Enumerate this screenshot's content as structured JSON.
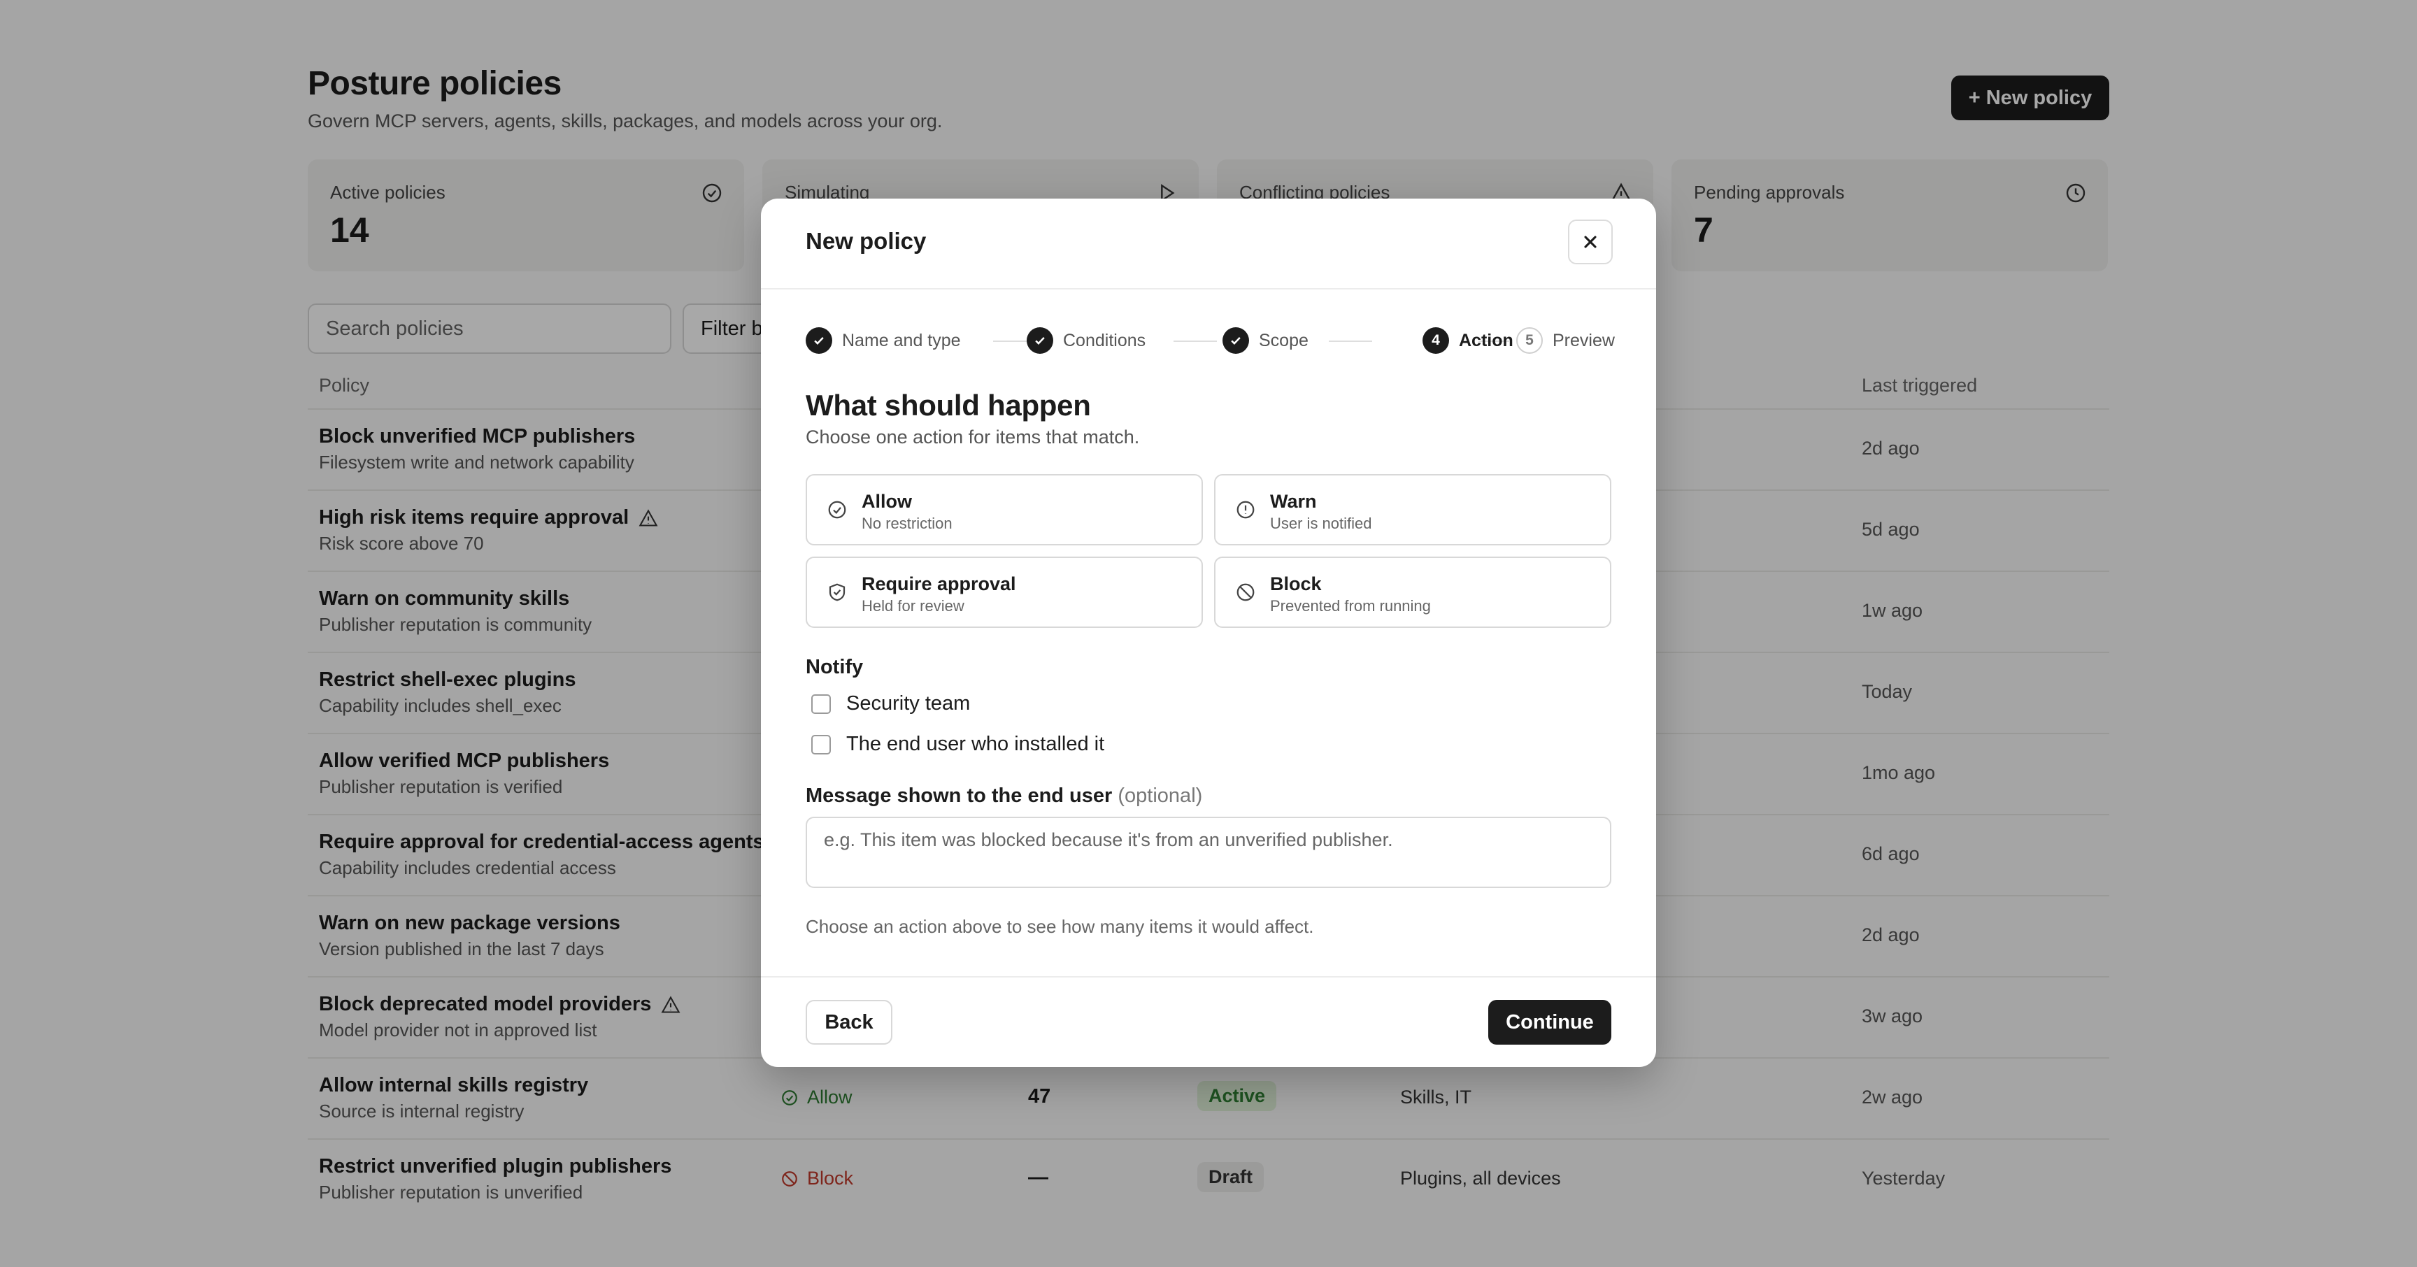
{
  "page": {
    "title": "Posture policies",
    "subtitle": "Govern MCP servers, agents, skills, packages, and models across your org.",
    "new_policy_label": "+ New policy"
  },
  "stats": [
    {
      "label": "Active policies",
      "value": "14",
      "icon": "check-circle-icon"
    },
    {
      "label": "Simulating",
      "value": "",
      "icon": "play-icon"
    },
    {
      "label": "Conflicting policies",
      "value": "",
      "icon": "warning-icon"
    },
    {
      "label": "Pending approvals",
      "value": "7",
      "icon": "clock-icon"
    }
  ],
  "toolbar": {
    "search_placeholder": "Search policies",
    "filter_label": "Filter b"
  },
  "table": {
    "columns": {
      "policy": "Policy",
      "last_triggered": "Last triggered"
    },
    "rows": [
      {
        "title": "Block unverified MCP publishers",
        "subtitle": "Filesystem write and network capability",
        "last_triggered": "2d ago"
      },
      {
        "title": "High risk items require approval",
        "subtitle": "Risk score above 70",
        "warning": true,
        "last_triggered": "5d ago"
      },
      {
        "title": "Warn on community skills",
        "subtitle": "Publisher reputation is community",
        "last_triggered": "1w ago"
      },
      {
        "title": "Restrict shell-exec plugins",
        "subtitle": "Capability includes shell_exec",
        "last_triggered": "Today"
      },
      {
        "title": "Allow verified MCP publishers",
        "subtitle": "Publisher reputation is verified",
        "last_triggered": "1mo ago"
      },
      {
        "title": "Require approval for credential-access agents",
        "subtitle": "Capability includes credential access",
        "last_triggered": "6d ago"
      },
      {
        "title": "Warn on new package versions",
        "subtitle": "Version published in the last 7 days",
        "last_triggered": "2d ago"
      },
      {
        "title": "Block deprecated model providers",
        "subtitle": "Model provider not in approved list",
        "warning": true,
        "last_triggered": "3w ago"
      },
      {
        "title": "Allow internal skills registry",
        "subtitle": "Source is internal registry",
        "action": "Allow",
        "count": "47",
        "status": "Active",
        "scope": "Skills, IT",
        "last_triggered": "2w ago"
      },
      {
        "title": "Restrict unverified plugin publishers",
        "subtitle": "Publisher reputation is unverified",
        "action": "Block",
        "count": "—",
        "status": "Draft",
        "scope": "Plugins, all devices",
        "last_triggered": "Yesterday"
      }
    ]
  },
  "modal": {
    "title": "New policy",
    "steps": [
      {
        "label": "Name and type",
        "state": "done"
      },
      {
        "label": "Conditions",
        "state": "done"
      },
      {
        "label": "Scope",
        "state": "done"
      },
      {
        "label": "Action",
        "state": "current",
        "number": "4"
      },
      {
        "label": "Preview",
        "state": "todo",
        "number": "5"
      }
    ],
    "heading": "What should happen",
    "description": "Choose one action for items that match.",
    "options": [
      {
        "label": "Allow",
        "sub": "No restriction",
        "icon": "check-circle-icon"
      },
      {
        "label": "Warn",
        "sub": "User is notified",
        "icon": "info-circle-icon"
      },
      {
        "label": "Require approval",
        "sub": "Held for review",
        "icon": "shield-check-icon"
      },
      {
        "label": "Block",
        "sub": "Prevented from running",
        "icon": "block-icon"
      }
    ],
    "notify_heading": "Notify",
    "notify_options": [
      "Security team",
      "The end user who installed it"
    ],
    "message_label": "Message shown to the end user",
    "message_optional": "(optional)",
    "message_placeholder": "e.g. This item was blocked because it's from an unverified publisher.",
    "hint": "Choose an action above to see how many items it would affect.",
    "back_label": "Back",
    "continue_label": "Continue"
  },
  "colors": {
    "accent": "#1c1c1c",
    "allow": "#2e7d32",
    "block": "#c0392b",
    "active_badge_bg": "#dff0d8",
    "draft_badge_bg": "#ececea"
  }
}
